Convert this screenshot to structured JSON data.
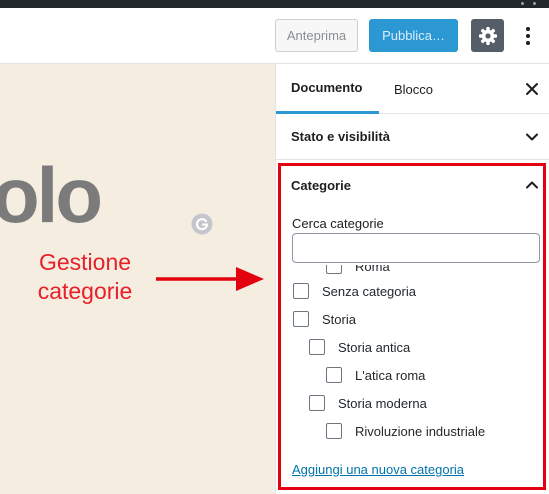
{
  "toolbar": {
    "preview_label": "Anteprima",
    "publish_label": "Pubblica…",
    "settings_icon": "gear-icon",
    "more_icon": "more-vertical-icon"
  },
  "canvas": {
    "title_fragment": "olo",
    "annotation_lines": [
      "Gestione",
      "categorie"
    ],
    "annotation_color": "#e8202a"
  },
  "sidebar": {
    "tabs": [
      {
        "label": "Documento",
        "active": true
      },
      {
        "label": "Blocco",
        "active": false
      }
    ],
    "panels": {
      "status": {
        "title": "Stato e visibilità",
        "expanded": false
      },
      "categories": {
        "title": "Categorie",
        "expanded": true,
        "search_label": "Cerca categorie",
        "search_value": "",
        "items": [
          {
            "label": "Roma",
            "level": 2,
            "checked": false
          },
          {
            "label": "Senza categoria",
            "level": 0,
            "checked": false
          },
          {
            "label": "Storia",
            "level": 0,
            "checked": false
          },
          {
            "label": "Storia antica",
            "level": 1,
            "checked": false
          },
          {
            "label": "L'atica roma",
            "level": 2,
            "checked": false
          },
          {
            "label": "Storia moderna",
            "level": 1,
            "checked": false
          },
          {
            "label": "Rivoluzione industriale",
            "level": 2,
            "checked": false
          }
        ],
        "add_link": "Aggiungi una nuova categoria"
      }
    }
  },
  "colors": {
    "accent": "#2b97d3",
    "highlight": "#e3000f",
    "canvas_bg": "#f4ede0"
  }
}
